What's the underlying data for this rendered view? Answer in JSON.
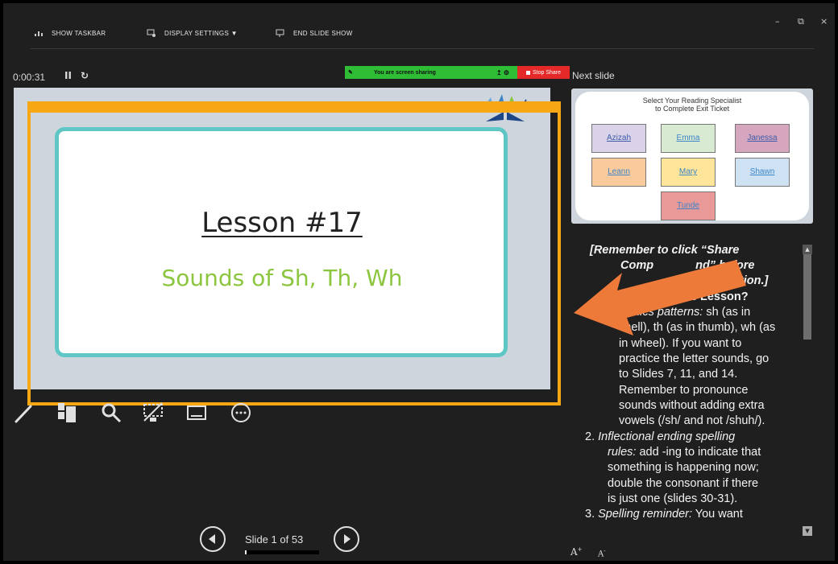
{
  "toolbar": {
    "show_taskbar": "SHOW TASKBAR",
    "display_settings": "DISPLAY SETTINGS ▼",
    "end_slide_show": "END SLIDE SHOW"
  },
  "window": {
    "minimize": "–",
    "restore": "⧉",
    "close": "×"
  },
  "timer": "0:00:31",
  "share_banner": {
    "text": "You are screen sharing",
    "stop_label": "Stop Share"
  },
  "next_slide_label": "Next slide",
  "current_slide": {
    "title": "Lesson #17",
    "subtitle": "Sounds of Sh, Th, Wh"
  },
  "next_slide": {
    "heading_line1": "Select Your Reading Specialist",
    "heading_line2": "to Complete Exit Ticket",
    "tiles": [
      "Azizah",
      "Emma",
      "Janessa",
      "Leann",
      "Mary",
      "Shawn",
      "Tunde"
    ]
  },
  "notes": {
    "l1": "[Remember to click “Share",
    "l2a": "Comp",
    "l2b": "nd” before",
    "l3": "esentation.]",
    "l4": "his Lesson?",
    "l5a": "onics patterns:",
    "l5b": " sh (as in",
    "l6": "shell), th (as in thumb), wh (as",
    "l7": "in wheel). If you want to",
    "l8": "practice the letter sounds, go",
    "l9": "to Slides 7, 11, and 14.",
    "l10": "Remember to pronounce",
    "l11": "sounds without adding extra",
    "l12": "vowels (/sh/ and not /shuh/).",
    "l13a": "2. ",
    "l13b": "Inflectional ending spelling",
    "l14a": "rules:",
    "l14b": " add -ing to indicate that",
    "l15": "something is happening now;",
    "l16": "double the consonant if there",
    "l17": "is just one (slides 30-31).",
    "l18a": "3. ",
    "l18b": "Spelling reminder:",
    "l18c": " You want"
  },
  "navigation": {
    "slide_counter": "Slide 1 of 53",
    "progress_fraction": 0.019
  },
  "font_controls": {
    "increase": "A",
    "decrease": "A"
  },
  "colors": {
    "accent_orange": "#f7a614",
    "arrow_orange": "#ee7a3a",
    "share_green": "#2ebd35",
    "stop_red": "#e52929",
    "card_teal": "#5ec7c5",
    "subtitle_green": "#8cc63f",
    "tile_colors": [
      "#d9d2e9",
      "#d9ead3",
      "#d5a6bd",
      "#f9cb9c",
      "#ffe599",
      "#cfe2f3",
      "#ea9999"
    ]
  },
  "icons": [
    "taskbar-icon",
    "display-settings-icon",
    "end-show-icon",
    "pause-icon",
    "reset-icon",
    "pen-icon",
    "slides-grid-icon",
    "zoom-icon",
    "black-screen-icon",
    "subtitles-icon",
    "more-options-icon",
    "prev-icon",
    "next-icon"
  ]
}
